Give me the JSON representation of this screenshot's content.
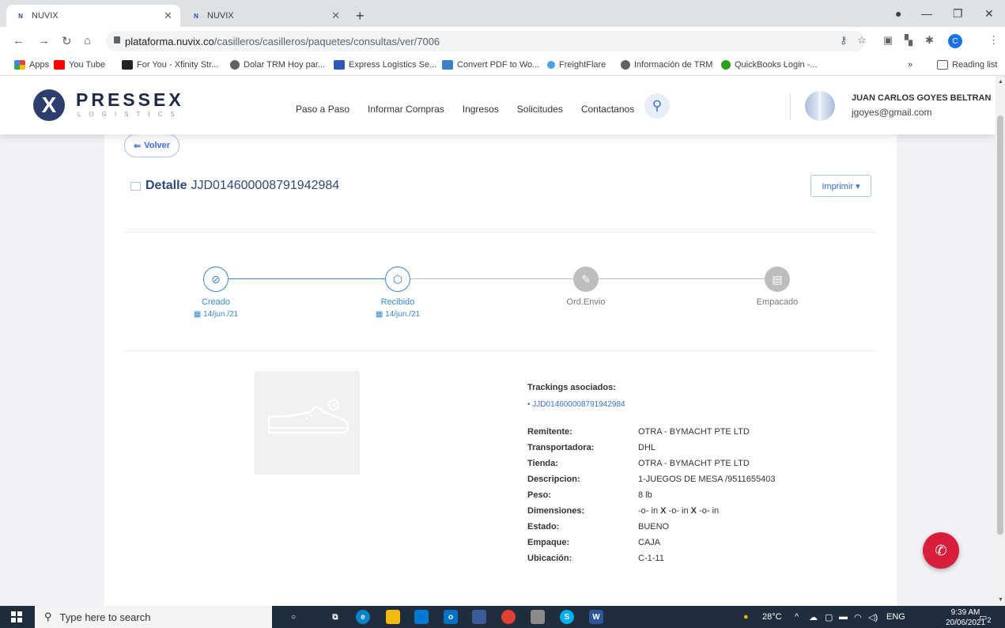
{
  "browser": {
    "tabs": [
      {
        "favicon": "N",
        "title": "NUVIX"
      },
      {
        "favicon": "N",
        "title": "NUVIX"
      }
    ],
    "url_domain": "plataforma.nuvix.co",
    "url_path": "/casilleros/casilleros/paquetes/consultas/ver/7006",
    "profile_initial": "C",
    "bookmarks": [
      {
        "label": "Apps",
        "color": "#ea4335"
      },
      {
        "label": "You Tube",
        "color": "#ff0000"
      },
      {
        "label": "For You - Xfinity Str...",
        "color": "#222222"
      },
      {
        "label": "Dolar TRM Hoy par...",
        "color": "#5f6368"
      },
      {
        "label": "Express Logistics Se...",
        "color": "#2d59b8"
      },
      {
        "label": "Convert PDF to Wo...",
        "color": "#3b82c4"
      },
      {
        "label": "FreightFlare",
        "color": "#4aa3df"
      },
      {
        "label": "Información de TRM",
        "color": "#5f6368"
      },
      {
        "label": "QuickBooks Login -...",
        "color": "#2ca01c"
      }
    ],
    "reading_list": "Reading list",
    "more": "»"
  },
  "header": {
    "logo_mark": "X",
    "logo_text": "PRESSEX",
    "logo_sub": "LOGISTICS",
    "nav": [
      "Paso a Paso",
      "Informar Compras",
      "Ingresos",
      "Solicitudes",
      "Contactanos"
    ],
    "user_name": "JUAN CARLOS GOYES BELTRAN",
    "user_email": "jgoyes@gmail.com"
  },
  "page": {
    "back_label": "Volver",
    "title_strong": "Detalle",
    "title_code": "JJD014600008791942984",
    "print_label": "Imprimir ▾"
  },
  "steps": [
    {
      "label": "Creado",
      "date": "14/jun./21",
      "state": "done",
      "icon": "check-circle-icon"
    },
    {
      "label": "Recibido",
      "date": "14/jun./21",
      "state": "done",
      "icon": "box-icon"
    },
    {
      "label": "Ord.Envio",
      "date": "",
      "state": "pending",
      "icon": "edit-icon"
    },
    {
      "label": "Empacado",
      "date": "",
      "state": "pending",
      "icon": "archive-icon"
    }
  ],
  "trackings": {
    "title": "Trackings asociados:",
    "items": [
      "JJD014600008791942984"
    ]
  },
  "details": {
    "remitente": {
      "label": "Remitente:",
      "value": "OTRA - BYMACHT PTE LTD"
    },
    "transportadora": {
      "label": "Transportadora:",
      "value": "DHL"
    },
    "tienda": {
      "label": "Tienda:",
      "value": "OTRA - BYMACHT PTE LTD"
    },
    "descripcion": {
      "label": "Descripcion:",
      "value": "1-JUEGOS DE MESA /9511655403"
    },
    "peso": {
      "label": "Peso:",
      "value": "8 lb"
    },
    "dimensiones": {
      "label": "Dimensiones:",
      "part1": "-o- in",
      "x1": "X",
      "part2": "-o- in",
      "x2": "X",
      "part3": "-o- in"
    },
    "estado": {
      "label": "Estado:",
      "value": "BUENO"
    },
    "empaque": {
      "label": "Empaque:",
      "value": "CAJA"
    },
    "ubicacion": {
      "label": "Ubicación:",
      "value": "C-1-11"
    }
  },
  "taskbar": {
    "search_placeholder": "Type here to search",
    "weather": "28°C",
    "lang": "ENG",
    "time": "9:39 AM",
    "date": "20/06/2021",
    "notif_count": "2"
  },
  "colors": {
    "accent": "#3a86d8",
    "brand_dark": "#1c2a48",
    "fab": "#d81e3c"
  }
}
